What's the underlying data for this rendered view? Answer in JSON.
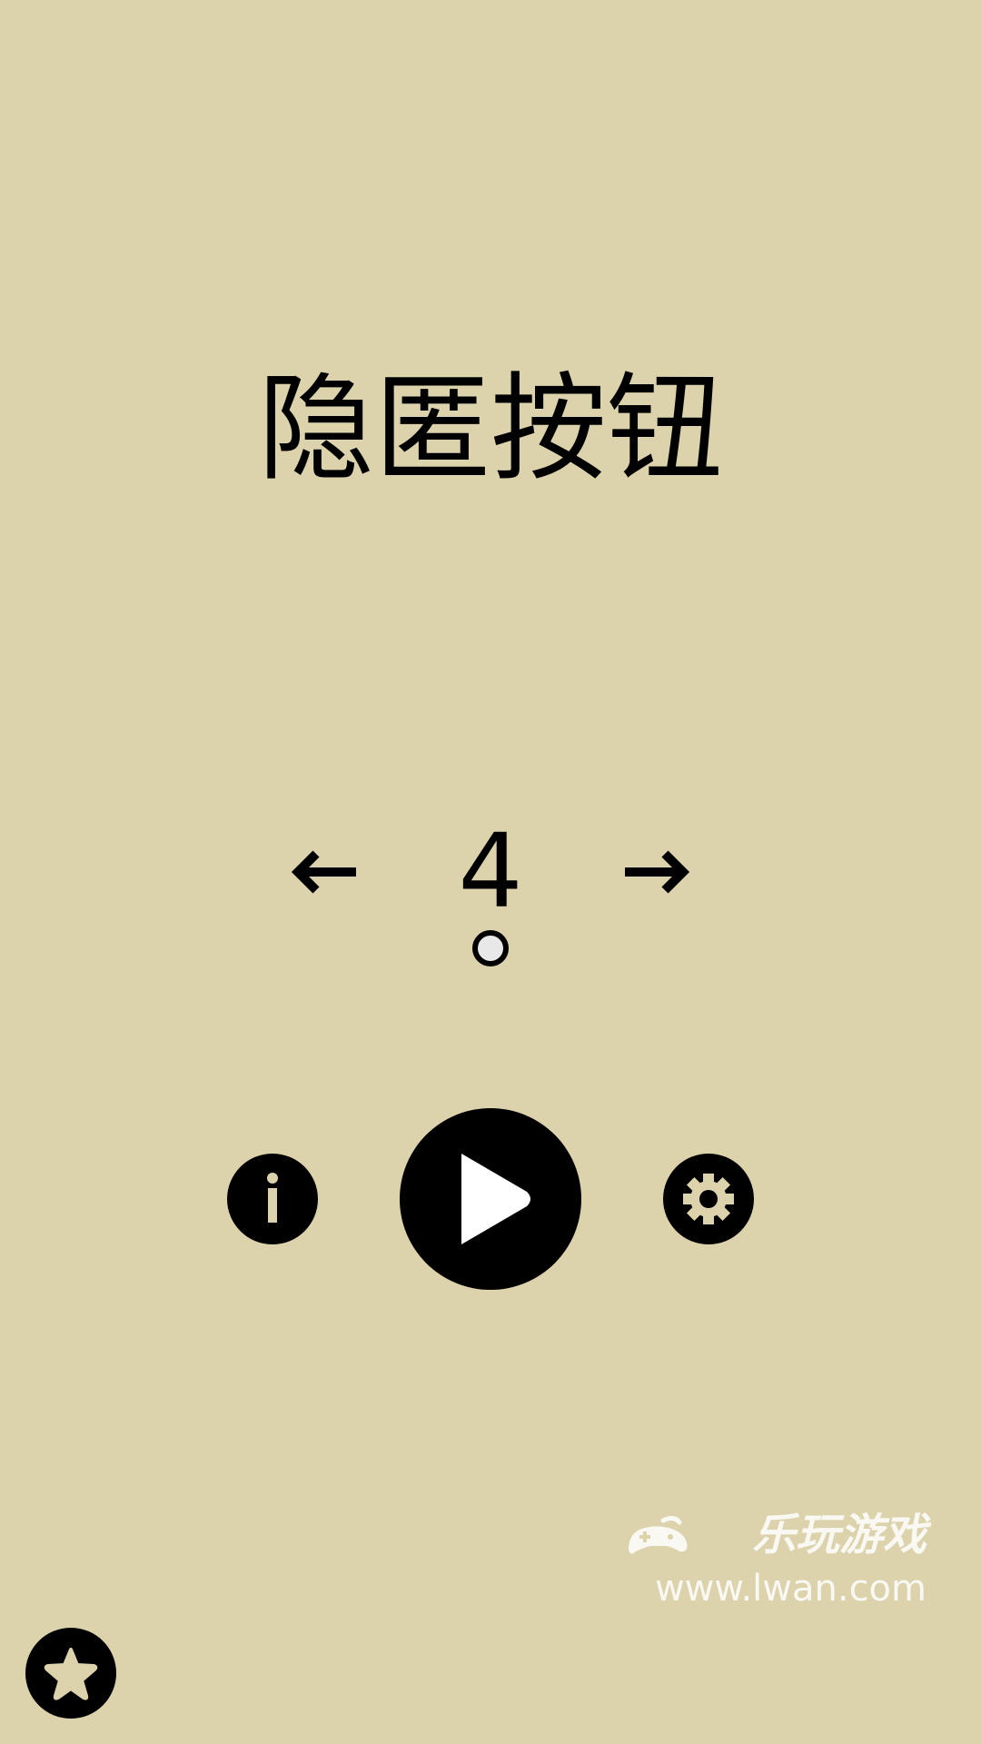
{
  "title": "隐匿按钮",
  "level": {
    "current": "4",
    "prev_icon": "arrow-left-icon",
    "next_icon": "arrow-right-icon",
    "indicator_icon": "level-dot-icon"
  },
  "controls": {
    "info_icon": "info-icon",
    "play_icon": "play-icon",
    "settings_icon": "gear-icon",
    "star_icon": "star-icon"
  },
  "watermark": {
    "brand": "乐玩游戏",
    "url": "www.lwan.com",
    "logo_icon": "gamepad-icon"
  },
  "colors": {
    "background": "#DCD3AD",
    "foreground": "#000000",
    "dot_fill": "#E8E8E8",
    "watermark": "#FFFFFF"
  }
}
